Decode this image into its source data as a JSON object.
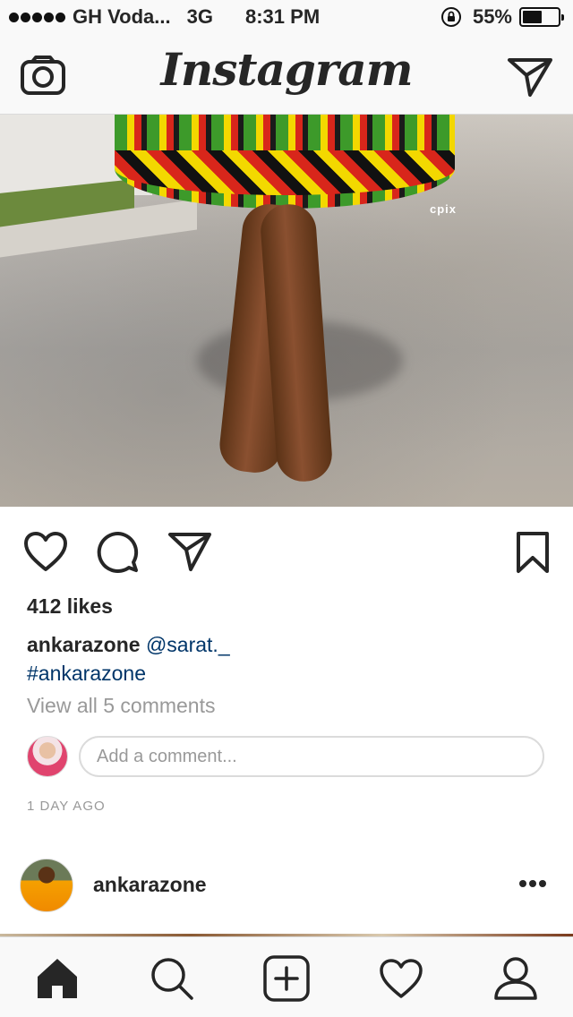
{
  "status_bar": {
    "carrier": "GH Voda...",
    "network": "3G",
    "time": "8:31 PM",
    "battery": "55%",
    "battery_level": 0.55
  },
  "nav": {
    "logo": "Instagram",
    "left_icon": "camera-icon",
    "right_icon": "direct-send-icon"
  },
  "photo": {
    "watermark": "cpix"
  },
  "post": {
    "likes": "412 likes",
    "caption_user": "ankarazone",
    "caption_mention": "@sarat._",
    "caption_hashtag": "#ankarazone",
    "view_comments": "View all 5 comments",
    "comment_placeholder": "Add a comment...",
    "timestamp": "1 DAY AGO"
  },
  "next_post": {
    "username": "ankarazone"
  },
  "tabs": [
    "home-icon",
    "search-icon",
    "add-post-icon",
    "activity-icon",
    "profile-icon"
  ]
}
